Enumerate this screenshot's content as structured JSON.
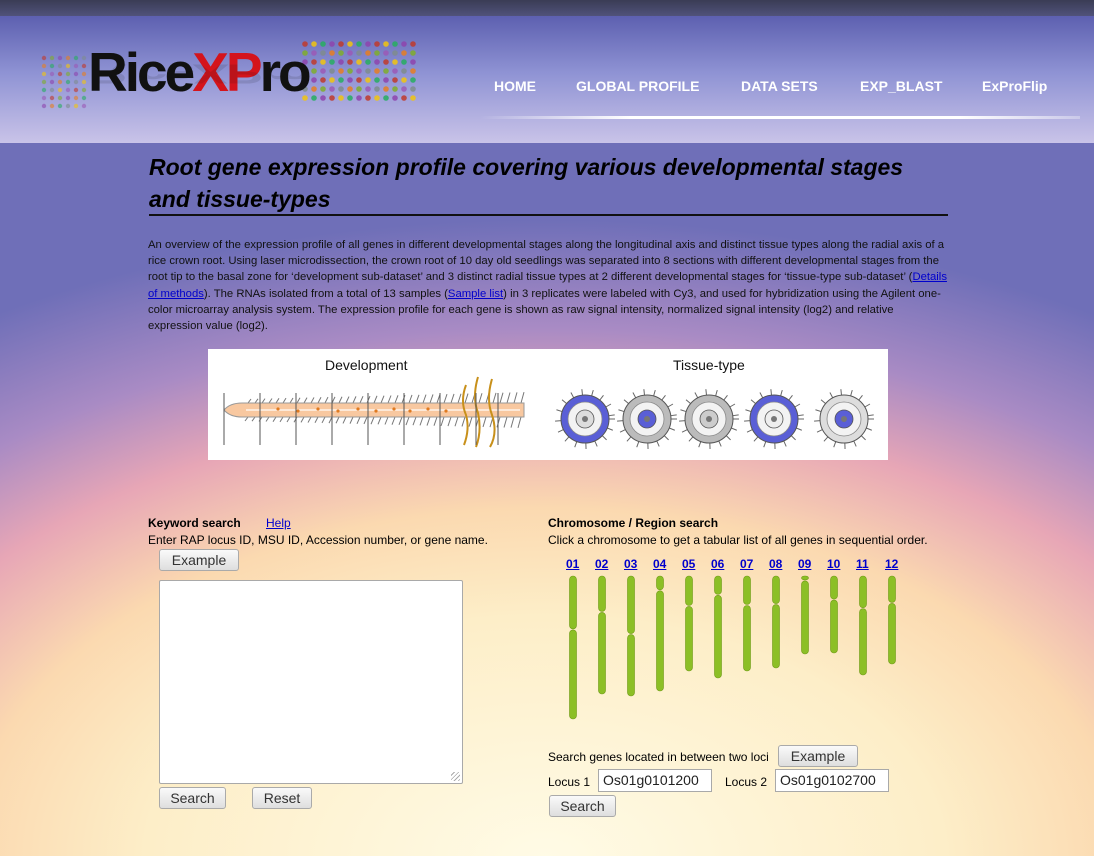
{
  "header": {
    "logo": {
      "part1": "Rice",
      "part2": "XP",
      "part3": "ro"
    },
    "nav": [
      "HOME",
      "GLOBAL PROFILE",
      "DATA SETS",
      "EXP_BLAST",
      "ExProFlip"
    ]
  },
  "title": "Root gene expression profile covering various developmental stages and tissue-types",
  "intro": {
    "p1": "An overview of the expression profile of all genes in different developmental stages along the longitudinal axis and distinct tissue types along the radial axis of a rice crown root. Using laser microdissection, the crown root of 10 day old seedlings was separated into 8 sections with different developmental stages from the root tip to the basal zone for ‘development sub-dataset’ and 3 distinct radial tissue types at 2 different developmental stages for ‘tissue-type sub-dataset’ (",
    "link1": "Details of methods",
    "p2": "). The RNAs isolated from a total of 13 samples (",
    "link2": "Sample list",
    "p3": ") in 3 replicates were labeled with Cy3, and used for hybridization using the Agilent one-color microarray analysis system. The expression profile for each gene is shown as raw signal intensity, normalized signal intensity (log2) and relative expression value (log2)."
  },
  "figure": {
    "left_label": "Development",
    "right_label": "Tissue-type"
  },
  "keyword": {
    "title": "Keyword search",
    "help": "Help",
    "desc": "Enter RAP locus ID, MSU ID, Accession number, or gene name.",
    "example": "Example",
    "textarea_value": "",
    "search": "Search",
    "reset": "Reset"
  },
  "chromosome": {
    "title": "Chromosome / Region search",
    "desc": "Click a chromosome to get a tabular list of all genes in sequential order.",
    "labels": [
      "01",
      "02",
      "03",
      "04",
      "05",
      "06",
      "07",
      "08",
      "09",
      "10",
      "11",
      "12"
    ],
    "locus_search_label": "Search genes located in between two loci",
    "example": "Example",
    "locus1_label": "Locus 1",
    "locus1_value": "Os01g0101200",
    "locus2_label": "Locus 2",
    "locus2_value": "Os01g0102700",
    "search": "Search"
  },
  "colors": {
    "accent_red": "#d4141c",
    "link_blue": "#0000cc",
    "chromosome_green": "#8cbf26"
  }
}
